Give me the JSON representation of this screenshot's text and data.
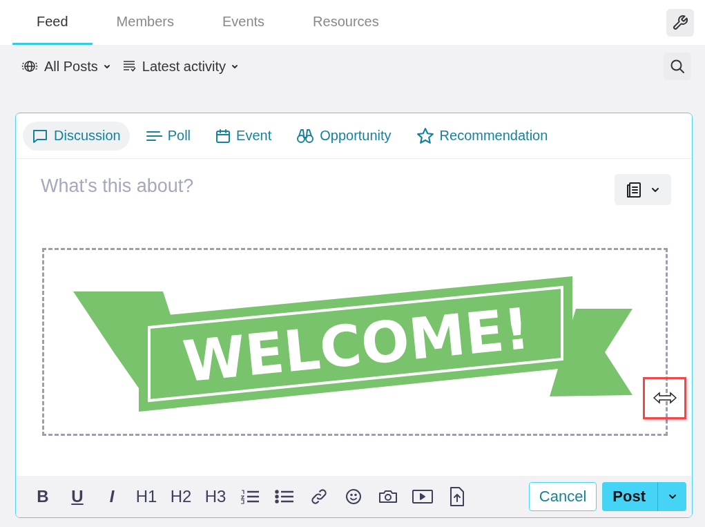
{
  "tabs": [
    {
      "label": "Feed",
      "selected": true
    },
    {
      "label": "Members",
      "selected": false
    },
    {
      "label": "Events",
      "selected": false
    },
    {
      "label": "Resources",
      "selected": false
    }
  ],
  "filters": [
    {
      "label": "All Posts"
    },
    {
      "label": "Latest activity"
    }
  ],
  "composer": {
    "post_types": [
      {
        "label": "Discussion",
        "selected": true
      },
      {
        "label": "Poll",
        "selected": false
      },
      {
        "label": "Event",
        "selected": false
      },
      {
        "label": "Opportunity",
        "selected": false
      },
      {
        "label": "Recommendation",
        "selected": false
      }
    ],
    "title_field": {
      "placeholder": "What's this about?"
    },
    "image": {
      "text": "WELCOME!"
    },
    "format_buttons": [
      {
        "label": "B",
        "kind": "bold"
      },
      {
        "label": "U",
        "kind": "underline"
      },
      {
        "label": "I",
        "kind": "italic"
      },
      {
        "label": "H1",
        "kind": "heading"
      },
      {
        "label": "H2",
        "kind": "heading"
      },
      {
        "label": "H3",
        "kind": "heading"
      }
    ],
    "cancel": "Cancel",
    "post": "Post"
  }
}
